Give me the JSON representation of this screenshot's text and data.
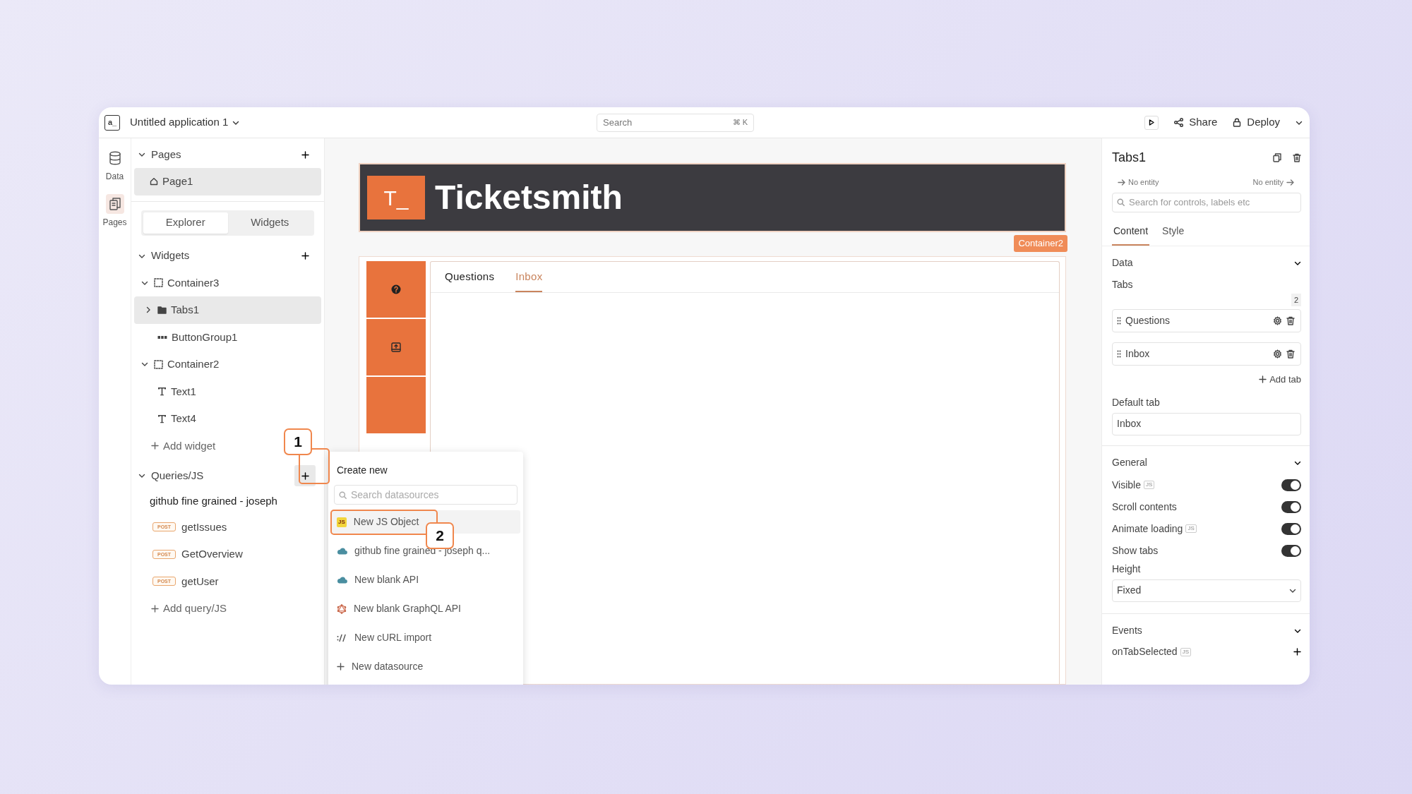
{
  "app": {
    "logo": "a_",
    "title": "Untitled application 1"
  },
  "search": {
    "placeholder": "Search",
    "shortcut": "⌘ K"
  },
  "actions": [
    {
      "kind": "share",
      "label": "Share"
    },
    {
      "kind": "deploy",
      "label": "Deploy"
    }
  ],
  "rail": [
    {
      "kind": "data",
      "label": "Data",
      "selected": false
    },
    {
      "kind": "pages",
      "label": "Pages",
      "selected": true
    }
  ],
  "pages": {
    "title": "Pages",
    "items": [
      {
        "label": "Page1",
        "selected": true
      }
    ]
  },
  "explorer_tabs": [
    {
      "label": "Explorer",
      "selected": true
    },
    {
      "label": "Widgets",
      "selected": false
    }
  ],
  "widgets": {
    "title": "Widgets",
    "add": "Add widget",
    "tree": [
      {
        "kind": "container",
        "label": "Container3",
        "expanded": true,
        "selected": false,
        "children": [
          {
            "kind": "tabs",
            "label": "Tabs1",
            "expanded": false,
            "selected": true
          },
          {
            "kind": "buttongroup",
            "label": "ButtonGroup1",
            "selected": false
          }
        ]
      },
      {
        "kind": "container",
        "label": "Container2",
        "expanded": true,
        "selected": false,
        "children": [
          {
            "kind": "text",
            "label": "Text1",
            "selected": false
          },
          {
            "kind": "text",
            "label": "Text4",
            "selected": false
          }
        ]
      }
    ]
  },
  "queries": {
    "title": "Queries/JS",
    "datasource": "github fine grained - joseph",
    "add": "Add query/JS",
    "items": [
      {
        "method": "POST",
        "label": "getIssues"
      },
      {
        "method": "POST",
        "label": "GetOverview"
      },
      {
        "method": "POST",
        "label": "getUser"
      }
    ]
  },
  "canvas": {
    "logo": "T_",
    "title": "Ticketsmith",
    "container_label": "Container2",
    "tabs": [
      {
        "label": "Questions",
        "selected": false
      },
      {
        "label": "Inbox",
        "selected": true
      }
    ]
  },
  "menu": {
    "title": "Create new",
    "placeholder": "Search datasources",
    "items": [
      {
        "kind": "js",
        "badge": "JS",
        "label": "New JS Object",
        "highlighted": true
      },
      {
        "kind": "cloud",
        "label": "github fine grained - joseph q...",
        "highlighted": false
      },
      {
        "kind": "cloud",
        "label": "New blank API",
        "highlighted": false
      },
      {
        "kind": "graphql",
        "label": "New blank GraphQL API",
        "highlighted": false
      },
      {
        "kind": "curl",
        "label": "New cURL import",
        "highlighted": false
      },
      {
        "kind": "plus",
        "label": "New datasource",
        "highlighted": false
      }
    ]
  },
  "annotations": [
    {
      "label": "1"
    },
    {
      "label": "2"
    }
  ],
  "properties": {
    "title": "Tabs1",
    "prev": "No entity",
    "next": "No entity",
    "search_placeholder": "Search for controls, labels etc",
    "tabs": [
      {
        "label": "Content",
        "selected": true
      },
      {
        "label": "Style",
        "selected": false
      }
    ],
    "data": {
      "title": "Data",
      "tabs_label": "Tabs",
      "count": "2",
      "tab_items": [
        "Questions",
        "Inbox"
      ],
      "add": "Add tab",
      "default_label": "Default tab",
      "default_value": "Inbox"
    },
    "general": {
      "title": "General",
      "toggles": [
        {
          "label": "Visible",
          "badge": "JS",
          "on": true
        },
        {
          "label": "Scroll contents",
          "on": true
        },
        {
          "label": "Animate loading",
          "badge": "JS",
          "on": true
        },
        {
          "label": "Show tabs",
          "on": true
        }
      ],
      "height_label": "Height",
      "height_value": "Fixed"
    },
    "events": {
      "title": "Events",
      "items": [
        {
          "label": "onTabSelected",
          "badge": "JS"
        }
      ]
    }
  }
}
